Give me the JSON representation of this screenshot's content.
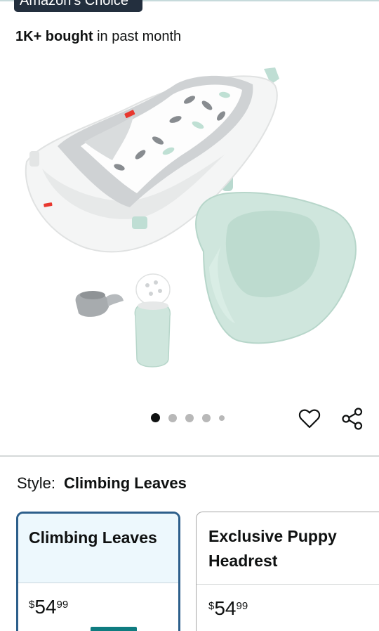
{
  "badge": {
    "label": "Amazon's Choice"
  },
  "social_proof": {
    "count": "1K+ bought",
    "suffix": " in past month"
  },
  "gallery": {
    "image_alt": "Fisher-Price 4-in-1 Sling 'n Seat Tub, Climbing Leaves",
    "total_images": 5,
    "active_index": 0,
    "icons": {
      "favorite": "heart-icon",
      "share": "share-icon"
    }
  },
  "style_selector": {
    "label": "Style:",
    "selected_value": "Climbing Leaves",
    "options": [
      {
        "name": "Climbing Leaves",
        "price_symbol": "$",
        "price_whole": "54",
        "price_fraction": "99",
        "selected": true
      },
      {
        "name": "Exclusive Puppy Headrest",
        "price_symbol": "$",
        "price_whole": "54",
        "price_fraction": "99",
        "selected": false
      }
    ]
  },
  "colors": {
    "badge_bg": "#232f3e",
    "selected_border": "#2d5f8b",
    "selected_bg": "#edf8fd",
    "tub_mint": "#cfe6dd"
  }
}
